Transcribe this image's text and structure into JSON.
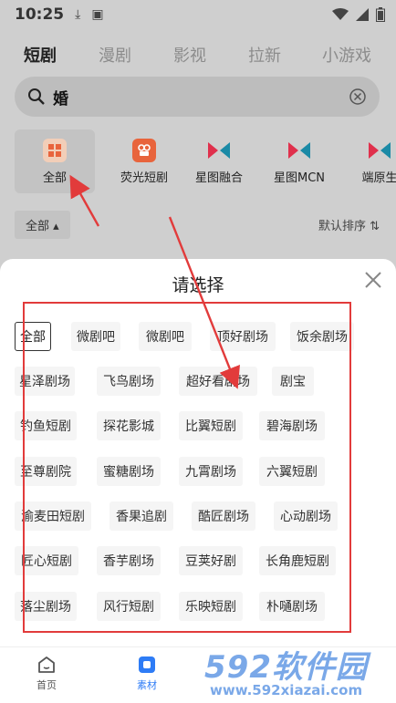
{
  "status_bar": {
    "time": "10:25"
  },
  "top_tabs": [
    "短剧",
    "漫剧",
    "影视",
    "拉新",
    "小游戏"
  ],
  "search": {
    "value": "婚"
  },
  "categories": [
    {
      "label": "全部",
      "icon": "grid-icon",
      "color": "#e8643c"
    },
    {
      "label": "荧光短剧",
      "icon": "film-icon",
      "color": "#e8643c"
    },
    {
      "label": "星图融合",
      "icon": "xingtu-logo-icon",
      "color": "#e0304c"
    },
    {
      "label": "星图MCN",
      "icon": "xingtu-logo-icon",
      "color": "#e0304c"
    },
    {
      "label": "端原生",
      "icon": "xingtu-logo-icon",
      "color": "#e0304c"
    }
  ],
  "filter": {
    "all_label": "全部",
    "sort_label": "默认排序"
  },
  "sheet": {
    "title": "请选择",
    "chips": [
      "全部",
      "微剧吧",
      "微剧吧",
      "顶好剧场",
      "饭余剧场",
      "星泽剧场",
      "飞鸟剧场",
      "超好看剧场",
      "剧宝",
      "钓鱼短剧",
      "探花影城",
      "比翼短剧",
      "碧海剧场",
      "至尊剧院",
      "蜜糖剧场",
      "九霄剧场",
      "六翼短剧",
      "渝麦田短剧",
      "香果追剧",
      "酷匠剧场",
      "心动剧场",
      "匠心短剧",
      "香芋剧场",
      "豆荚好剧",
      "长角鹿短剧",
      "落尘剧场",
      "风行短剧",
      "乐映短剧",
      "朴嗵剧场"
    ]
  },
  "bottom_nav": [
    {
      "label": "首页",
      "icon": "home-icon"
    },
    {
      "label": "素材",
      "icon": "material-icon"
    }
  ],
  "watermark": {
    "main": "592软件园",
    "url": "www.592xiazai.com"
  },
  "colors": {
    "accent_blue": "#2e7cf6",
    "annotation_red": "#e23b3b"
  }
}
